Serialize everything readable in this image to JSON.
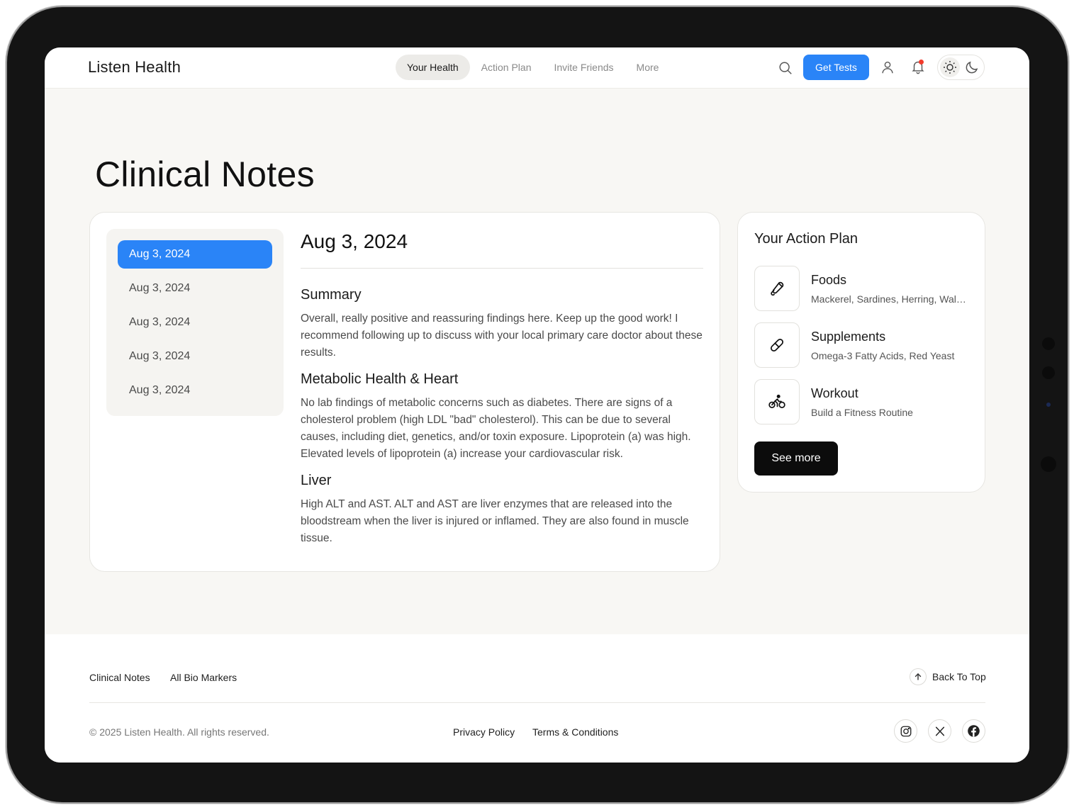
{
  "header": {
    "brand": "Listen Health",
    "nav": [
      "Your Health",
      "Action Plan",
      "Invite Friends",
      "More"
    ],
    "cta": "Get Tests"
  },
  "page": {
    "title": "Clinical Notes"
  },
  "notes": {
    "dates": [
      "Aug 3, 2024",
      "Aug 3, 2024",
      "Aug 3, 2024",
      "Aug 3, 2024",
      "Aug 3, 2024"
    ],
    "selected_date": "Aug 3, 2024",
    "sections": [
      {
        "heading": "Summary",
        "text": "Overall, really positive and reassuring findings here. Keep up the good work! I recommend following up to discuss with your local primary care doctor about these results."
      },
      {
        "heading": "Metabolic Health & Heart",
        "text": "No lab findings of metabolic concerns such as diabetes. There are signs of a cholesterol problem (high LDL \"bad\" cholesterol). This can be due to several causes, including diet, genetics, and/or toxin exposure. Lipoprotein (a) was high. Elevated levels of lipoprotein (a) increase your cardiovascular risk."
      },
      {
        "heading": "Liver",
        "text": "High ALT and AST. ALT and AST are liver enzymes that are released into the bloodstream when the liver is injured or inflamed. They are also found in muscle tissue."
      }
    ]
  },
  "action_plan": {
    "title": "Your Action Plan",
    "items": [
      {
        "name": "Foods",
        "sub": "Mackerel, Sardines, Herring, Walnuts",
        "icon": "food-icon"
      },
      {
        "name": "Supplements",
        "sub": "Omega-3 Fatty Acids, Red Yeast",
        "icon": "pill-icon"
      },
      {
        "name": "Workout",
        "sub": "Build a Fitness Routine",
        "icon": "bicycle-icon"
      }
    ],
    "see_more": "See more"
  },
  "footer": {
    "links": [
      "Clinical Notes",
      "All Bio Markers"
    ],
    "back_to_top": "Back To Top",
    "copyright": "© 2025 Listen Health. All rights reserved.",
    "legal": [
      "Privacy Policy",
      "Terms & Conditions"
    ],
    "social": [
      "instagram-icon",
      "x-icon",
      "facebook-icon"
    ]
  },
  "colors": {
    "accent": "#2a84f7",
    "background": "#f8f7f4",
    "dark_button": "#0c0c0c",
    "notification": "#f23b2c"
  }
}
